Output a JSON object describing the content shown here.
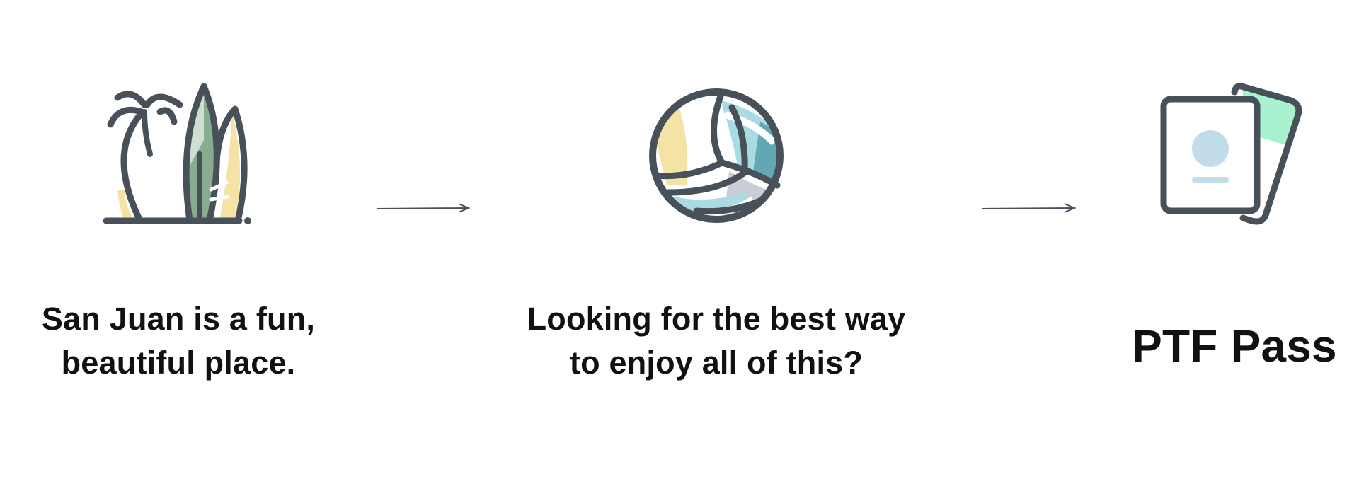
{
  "steps": [
    {
      "icon": "palm-surfboards-icon",
      "caption_line1": "San Juan is a fun,",
      "caption_line2": "beautiful place."
    },
    {
      "icon": "volleyball-icon",
      "caption_line1": "Looking for the best way",
      "caption_line2": "to enjoy all of this?"
    },
    {
      "icon": "pass-cards-icon",
      "caption_line1": "PTF Pass"
    }
  ],
  "arrows": [
    {
      "icon": "arrow-right-icon"
    },
    {
      "icon": "arrow-right-icon"
    }
  ],
  "colors": {
    "outline": "#48505a",
    "green": "#89ab90",
    "yellow": "#f5e3a5",
    "light_blue": "#a9dbe4",
    "teal": "#62a8b3",
    "gray": "#c9ced6",
    "mint": "#a8f2cf",
    "portrait_blue": "#c2dcea",
    "text": "#111111"
  }
}
